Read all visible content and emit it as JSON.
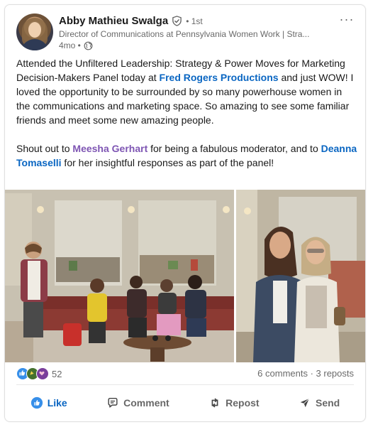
{
  "post": {
    "author": {
      "name": "Abby Mathieu Swalga",
      "degree": "• 1st",
      "headline": "Director of Communications at Pennsylvania Women Work | Stra...",
      "time": "4mo •",
      "verified_icon": "verified-shield-icon",
      "visibility_icon": "globe-icon"
    },
    "more_label": "···",
    "paragraph1": {
      "before": "Attended the Unfiltered Leadership: Strategy & Power Moves for Marketing Decision-Makers Panel today at ",
      "mention": "Fred Rogers Productions",
      "after": " and just WOW! I loved the opportunity to be surrounded by so many powerhouse women in the communications and marketing space. So amazing to see some familiar friends and meet some new amazing people."
    },
    "paragraph2": {
      "before": "Shout out to ",
      "mention1": "Meesha Gerhart",
      "middle": " for being a fabulous moderator, and to ",
      "mention2": "Deanna Tomaselli",
      "after": " for her insightful responses as part of the panel!"
    },
    "images": [
      {
        "name": "panel-photo",
        "description_icon": "photo"
      },
      {
        "name": "friends-photo",
        "description_icon": "photo"
      }
    ]
  },
  "social": {
    "reaction_count": "52",
    "comments_reposts": "6 comments · 3 reposts"
  },
  "actions": {
    "like": "Like",
    "comment": "Comment",
    "repost": "Repost",
    "send": "Send"
  },
  "colors": {
    "link_blue": "#0a66c2",
    "mention_purple": "#7e55b3",
    "like_blue": "#378fe9",
    "celebrate_green": "#44712e",
    "support_purple": "#7a3e9b"
  }
}
